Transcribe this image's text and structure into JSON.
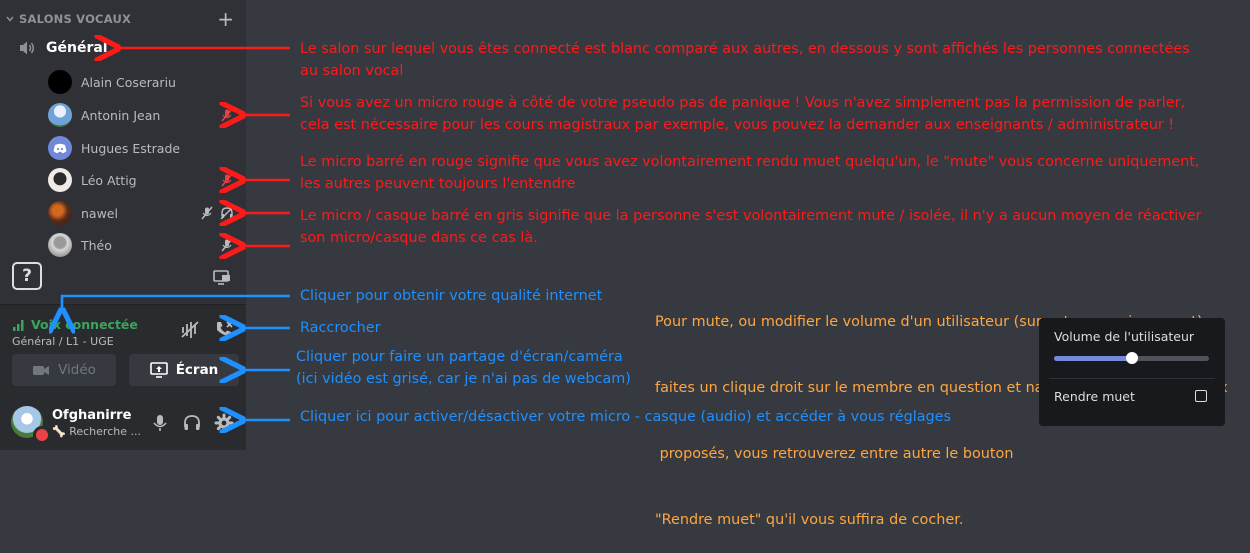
{
  "sidebar": {
    "category_label": "SALONS VOCAUX",
    "add_icon": "plus-icon",
    "channel_name": "Général",
    "users": [
      {
        "name": "Alain Coserariu",
        "avatar_color": "#000000",
        "icons": []
      },
      {
        "name": "Antonin Jean",
        "avatar_color": "#6fa3d8",
        "icons": [
          "mic-muted-red-icon"
        ]
      },
      {
        "name": "Hugues Estrade",
        "avatar_color": "#7289da",
        "icons": []
      },
      {
        "name": "Léo Attig",
        "avatar_color": "#e8e0d8",
        "icons": [
          "mic-muted-red-icon"
        ]
      },
      {
        "name": "nawel",
        "avatar_color": "#a0522d",
        "icons": [
          "mic-muted-gray-icon",
          "headset-deafened-gray-icon"
        ]
      },
      {
        "name": "Théo",
        "avatar_color": "#c8c8c8",
        "icons": [
          "mic-muted-gray-icon"
        ]
      }
    ]
  },
  "voice_panel": {
    "status": "Voix connectée",
    "subtitle": "Général / L1 - UGE",
    "status_color": "#3ba55d"
  },
  "buttons": {
    "video": "Vidéo",
    "screen": "Écran"
  },
  "user_bar": {
    "username": "Ofghanirre",
    "status": "Recherche ..."
  },
  "annotations": {
    "channel": [
      "Le salon sur lequel vous êtes connecté est blanc comparé aux autres, en dessous y sont affichés les personnes connectées",
      "au salon vocal"
    ],
    "red_mic": [
      "Si vous avez un micro rouge à côté de votre pseudo pas de panique ! Vous n'avez simplement pas la permission de parler,",
      "cela est nécessaire pour les cours magistraux par exemple, vous pouvez la demander aux enseignants / administrateur !"
    ],
    "mute": [
      "Le micro barré en rouge signifie que vous avez volontairement rendu muet quelqu'un, le \"mute\" vous concerne uniquement,",
      "les autres peuvent toujours l'entendre"
    ],
    "gray_mute": [
      "Le micro / casque barré en gris signifie que la personne s'est volontairement mute / isolée, il n'y a aucun moyen de réactiver",
      "son micro/casque dans ce cas là."
    ],
    "quality": "Cliquer pour obtenir votre qualité internet",
    "hangup": "Raccrocher",
    "share": [
      "Cliquer pour faire un partage d'écran/caméra",
      "(ici vidéo est grisé, car je n'ai pas de webcam)"
    ],
    "settings": "Cliquer ici pour activer/désactiver votre micro - casque (audio) et accéder à vous réglages",
    "volume": [
      "Pour mute, ou modifier le volume d'un utilisateur (sur votre pc uniquement),",
      "faites un clique droit sur le membre en question et naviguez à travers les choix",
      " proposés, vous retrouverez entre autre le bouton",
      "\"Rendre muet\" qu'il vous suffira de cocher."
    ]
  },
  "context_menu": {
    "volume_label": "Volume de l'utilisateur",
    "volume_level": 0.5,
    "mute_label": "Rendre muet",
    "mute_checked": false
  },
  "colors": {
    "annotation_red": "#ff1a1a",
    "annotation_blue": "#1e90ff",
    "annotation_orange": "#ffa640"
  }
}
